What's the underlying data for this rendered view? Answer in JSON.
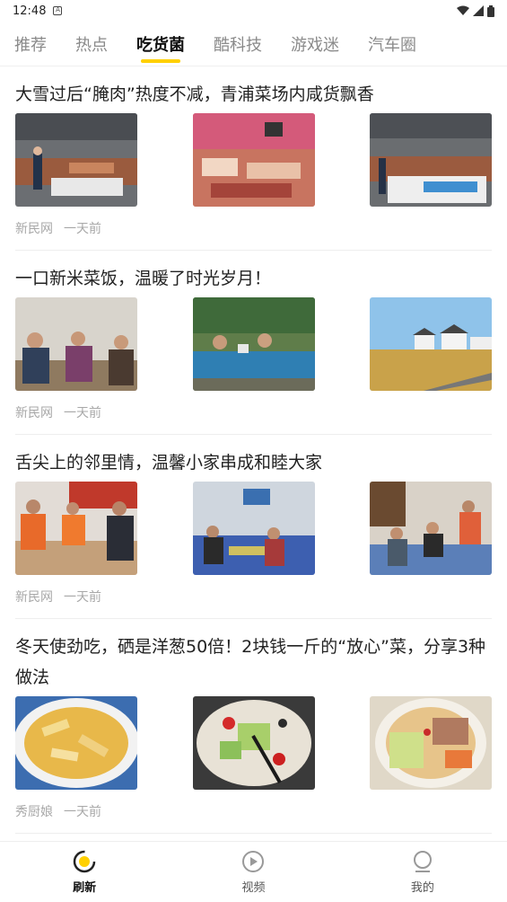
{
  "status_bar": {
    "time": "12:48",
    "notification_icon": "A"
  },
  "tabs": [
    {
      "label": "推荐",
      "active": false
    },
    {
      "label": "热点",
      "active": false
    },
    {
      "label": "吃货菌",
      "active": true
    },
    {
      "label": "酷科技",
      "active": false
    },
    {
      "label": "游戏迷",
      "active": false
    },
    {
      "label": "汽车圈",
      "active": false
    }
  ],
  "articles": [
    {
      "title": "大雪过后“腌肉”热度不减，青浦菜场内咸货飘香",
      "source": "新民网",
      "time": "一天前",
      "images": [
        "market-stall-photo",
        "cured-meat-counter-photo",
        "market-aisle-photo"
      ]
    },
    {
      "title": "一口新米菜饭，温暖了时光岁月！",
      "source": "新民网",
      "time": "一天前",
      "images": [
        "elders-eating-photo",
        "outdoor-table-photo",
        "village-field-photo"
      ]
    },
    {
      "title": "舌尖上的邻里情，温馨小家串成和睦大家",
      "source": "新民网",
      "time": "一天前",
      "images": [
        "volunteers-dumplings-photo",
        "community-hall-photo",
        "neighbors-meal-photo"
      ]
    },
    {
      "title": "冬天使劲吃，硒是洋葱50倍！2块钱一斤的“放心”菜，分享3种做法",
      "source": "秀厨娘",
      "time": "一天前",
      "images": [
        "stirfry-plate-photo",
        "vegetable-stirfry-photo",
        "soup-bowl-photo"
      ]
    }
  ],
  "bottom_nav": [
    {
      "label": "刷新",
      "icon": "refresh-icon",
      "active": true
    },
    {
      "label": "视频",
      "icon": "play-icon",
      "active": false
    },
    {
      "label": "我的",
      "icon": "profile-icon",
      "active": false
    }
  ],
  "colors": {
    "accent": "#ffd000",
    "inactive_tab": "#8a8a8a",
    "meta_text": "#a8a8a8"
  }
}
